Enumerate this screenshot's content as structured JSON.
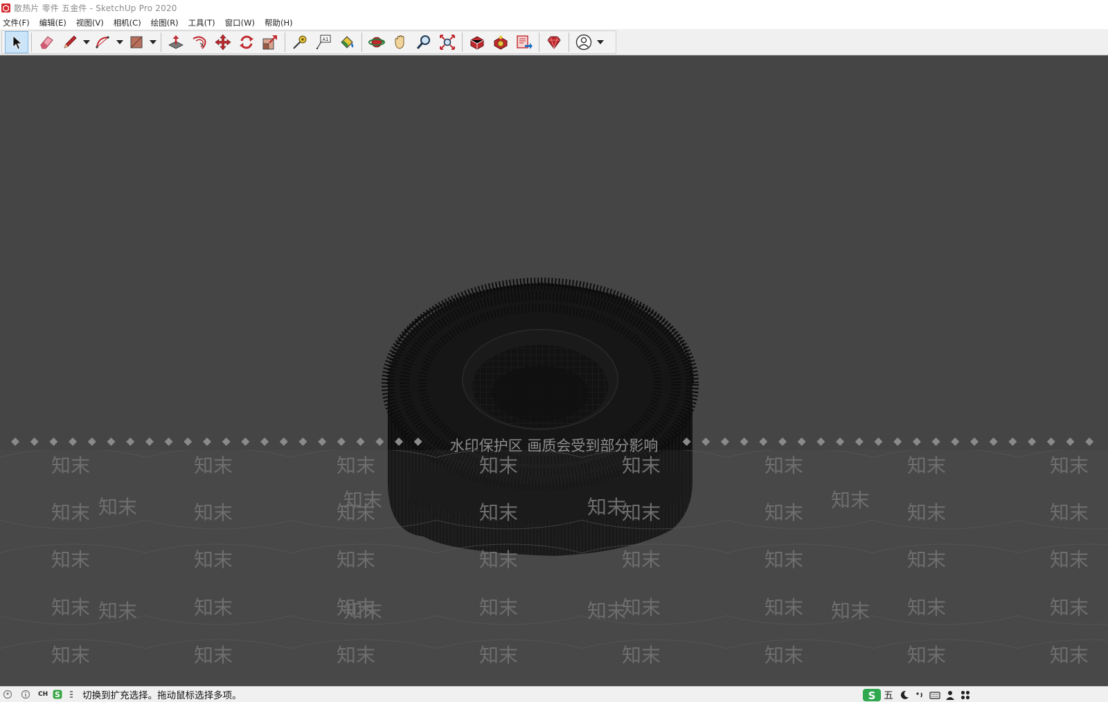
{
  "window": {
    "title": "散热片 零件 五金件 - SketchUp Pro 2020"
  },
  "menubar": {
    "items": [
      "文件(F)",
      "编辑(E)",
      "视图(V)",
      "相机(C)",
      "绘图(R)",
      "工具(T)",
      "窗口(W)",
      "帮助(H)"
    ]
  },
  "toolbar": {
    "tools": [
      {
        "id": "select",
        "icon": "select-arrow-icon"
      },
      {
        "id": "eraser",
        "icon": "eraser-icon"
      },
      {
        "id": "line",
        "icon": "pencil-icon"
      },
      {
        "id": "arc",
        "icon": "arc-icon"
      },
      {
        "id": "shape",
        "icon": "rectangle-icon"
      },
      {
        "id": "push-pull",
        "icon": "push-pull-icon"
      },
      {
        "id": "offset",
        "icon": "offset-icon"
      },
      {
        "id": "move",
        "icon": "move-icon"
      },
      {
        "id": "rotate",
        "icon": "rotate-icon"
      },
      {
        "id": "scale",
        "icon": "scale-icon"
      },
      {
        "id": "tape",
        "icon": "tape-measure-icon"
      },
      {
        "id": "text",
        "icon": "text-icon"
      },
      {
        "id": "paint",
        "icon": "paint-bucket-icon"
      },
      {
        "id": "orbit",
        "icon": "orbit-icon"
      },
      {
        "id": "pan",
        "icon": "pan-hand-icon"
      },
      {
        "id": "zoom",
        "icon": "zoom-icon"
      },
      {
        "id": "zoom-extents",
        "icon": "zoom-extents-icon"
      },
      {
        "id": "warehouse",
        "icon": "3d-warehouse-icon"
      },
      {
        "id": "extensions",
        "icon": "extension-warehouse-icon"
      },
      {
        "id": "layout",
        "icon": "send-to-layout-icon"
      },
      {
        "id": "ruby",
        "icon": "ruby-console-icon"
      },
      {
        "id": "account",
        "icon": "user-account-icon"
      }
    ]
  },
  "viewport": {
    "watermark_banner": "水印保护区  画质会受到部分影响",
    "watermark_tile": "知末"
  },
  "statusbar": {
    "ime_label": "CH",
    "message": "切换到扩充选择。拖动鼠标选择多项。"
  },
  "tray": {
    "ime_mode": "五"
  },
  "colors": {
    "viewport_bg": "#454545",
    "model": "#151515",
    "accent_red": "#c0282d"
  }
}
